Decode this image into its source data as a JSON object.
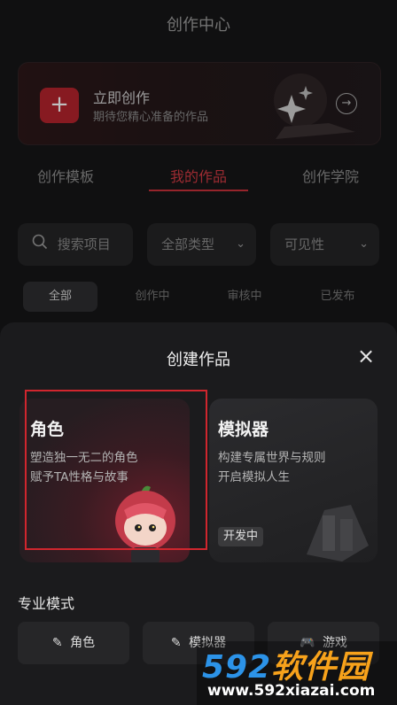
{
  "header": {
    "title": "创作中心"
  },
  "hero": {
    "title": "立即创作",
    "subtitle": "期待您精心准备的作品",
    "plus_icon": "+",
    "arrow_icon": "→"
  },
  "tabs": [
    {
      "label": "创作模板",
      "active": false
    },
    {
      "label": "我的作品",
      "active": true
    },
    {
      "label": "创作学院",
      "active": false
    }
  ],
  "filters": {
    "search_placeholder": "搜索项目",
    "type_select": "全部类型",
    "visibility_select": "可见性"
  },
  "status_pills": [
    {
      "label": "全部",
      "active": true
    },
    {
      "label": "创作中",
      "active": false
    },
    {
      "label": "审核中",
      "active": false
    },
    {
      "label": "已发布",
      "active": false
    }
  ],
  "sheet": {
    "title": "创建作品",
    "close_icon": "×",
    "cards": [
      {
        "title": "角色",
        "desc_line1": "塑造独一无二的角色",
        "desc_line2": "赋予TA性格与故事"
      },
      {
        "title": "模拟器",
        "desc_line1": "构建专属世界与规则",
        "desc_line2": "开启模拟人生",
        "badge": "开发中"
      }
    ],
    "pro_mode": {
      "label": "专业模式",
      "buttons": [
        {
          "label": "角色"
        },
        {
          "label": "模拟器"
        },
        {
          "label": "游戏"
        }
      ]
    }
  },
  "watermark": {
    "brand_num": "592",
    "brand_text": "软件园",
    "url": "www.592xiazai.com"
  },
  "colors": {
    "accent": "#c8303a",
    "background": "#161617",
    "sheet": "#1b1b1d"
  }
}
